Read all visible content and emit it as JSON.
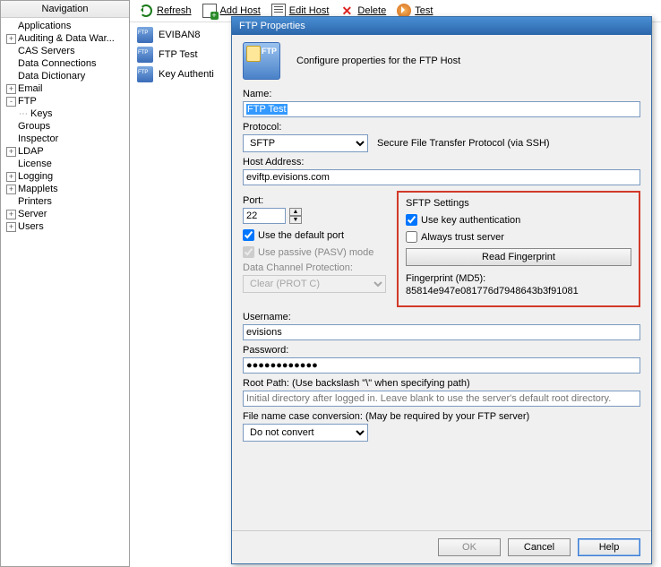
{
  "nav": {
    "title": "Navigation",
    "items": [
      {
        "label": "Applications",
        "exp": ""
      },
      {
        "label": "Auditing & Data War...",
        "exp": "+"
      },
      {
        "label": "CAS Servers",
        "exp": ""
      },
      {
        "label": "Data Connections",
        "exp": ""
      },
      {
        "label": "Data Dictionary",
        "exp": ""
      },
      {
        "label": "Email",
        "exp": "+"
      },
      {
        "label": "FTP",
        "exp": "-",
        "selected": false
      },
      {
        "label": "Keys",
        "exp": "",
        "child": true
      },
      {
        "label": "Groups",
        "exp": ""
      },
      {
        "label": "Inspector",
        "exp": ""
      },
      {
        "label": "LDAP",
        "exp": "+"
      },
      {
        "label": "License",
        "exp": ""
      },
      {
        "label": "Logging",
        "exp": "+"
      },
      {
        "label": "Mapplets",
        "exp": "+"
      },
      {
        "label": "Printers",
        "exp": ""
      },
      {
        "label": "Server",
        "exp": "+"
      },
      {
        "label": "Users",
        "exp": "+"
      }
    ]
  },
  "toolbar": {
    "refresh": "Refresh",
    "addhost": "Add Host",
    "edithost": "Edit Host",
    "delete": "Delete",
    "test": "Test"
  },
  "list": {
    "items": [
      "EVIBAN8",
      "FTP Test",
      "Key Authenti"
    ]
  },
  "dialog": {
    "title": "FTP Properties",
    "subtitle": "Configure properties for the FTP Host",
    "name_label": "Name:",
    "name_value": "FTP Test",
    "protocol_label": "Protocol:",
    "protocol_value": "SFTP",
    "protocol_desc": "Secure File Transfer Protocol (via SSH)",
    "host_label": "Host Address:",
    "host_value": "eviftp.evisions.com",
    "port_label": "Port:",
    "port_value": "22",
    "default_port": "Use the default port",
    "pasv": "Use passive (PASV) mode",
    "dcp_label": "Data Channel Protection:",
    "dcp_value": "Clear (PROT C)",
    "sftp": {
      "title": "SFTP Settings",
      "keyauth": "Use key authentication",
      "trust": "Always trust server",
      "readfp": "Read Fingerprint",
      "fp_label": "Fingerprint (MD5):",
      "fp_value": "85814e947e081776d7948643b3f91081"
    },
    "user_label": "Username:",
    "user_value": "evisions",
    "pass_label": "Password:",
    "pass_value": "●●●●●●●●●●●●",
    "root_label": "Root Path: (Use backslash \"\\\" when specifying path)",
    "root_placeholder": "Initial directory after logged in. Leave blank to use the server's default root directory.",
    "case_label": "File name case conversion: (May be required by your FTP server)",
    "case_value": "Do not convert",
    "ok": "OK",
    "cancel": "Cancel",
    "help": "Help"
  }
}
